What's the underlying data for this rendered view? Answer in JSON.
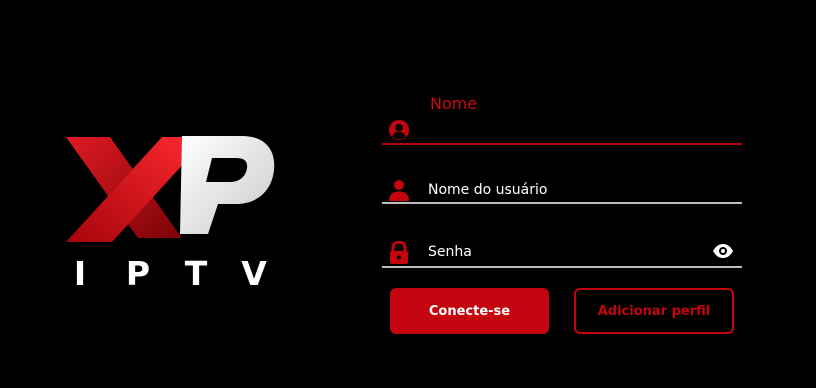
{
  "logo": {
    "brand_letters": "XP",
    "subtitle_letters": [
      "I",
      "P",
      "T",
      "V"
    ]
  },
  "form": {
    "name_field": {
      "label": "Nome",
      "icon": "person-circle-icon",
      "value": ""
    },
    "username_field": {
      "placeholder": "Nome do usuário",
      "icon": "person-icon"
    },
    "password_field": {
      "placeholder": "Senha",
      "icon": "lock-icon",
      "toggle_icon": "eye-icon"
    }
  },
  "buttons": {
    "connect_label": "Conecte-se",
    "add_profile_label": "Adicionar perfil"
  },
  "colors": {
    "background": "#000000",
    "accent": "#c4040e",
    "text": "#ffffff",
    "underline": "#bdbdbd"
  }
}
